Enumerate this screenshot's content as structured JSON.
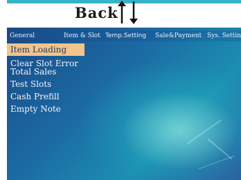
{
  "header": {
    "back_label": "Back"
  },
  "tabs": [
    {
      "label": "General"
    },
    {
      "label": "Item & Slot"
    },
    {
      "label": "Temp.Setting"
    },
    {
      "label": "Sale&Payment"
    },
    {
      "label": "Sys. Setting"
    }
  ],
  "menu": [
    {
      "label": "Item Loading",
      "selected": true
    },
    {
      "label": "Clear Slot Error"
    },
    {
      "label": "Total Sales"
    },
    {
      "label": "Test Slots"
    },
    {
      "label": "Cash Prefill"
    },
    {
      "label": "Empty Note"
    }
  ],
  "colors": {
    "accent_strip": "#36b3c6",
    "selected_item_bg": "#f2c48b",
    "panel_blue": "#1b6aa3"
  },
  "icons": [
    "arrow-up-icon",
    "arrow-down-icon"
  ]
}
